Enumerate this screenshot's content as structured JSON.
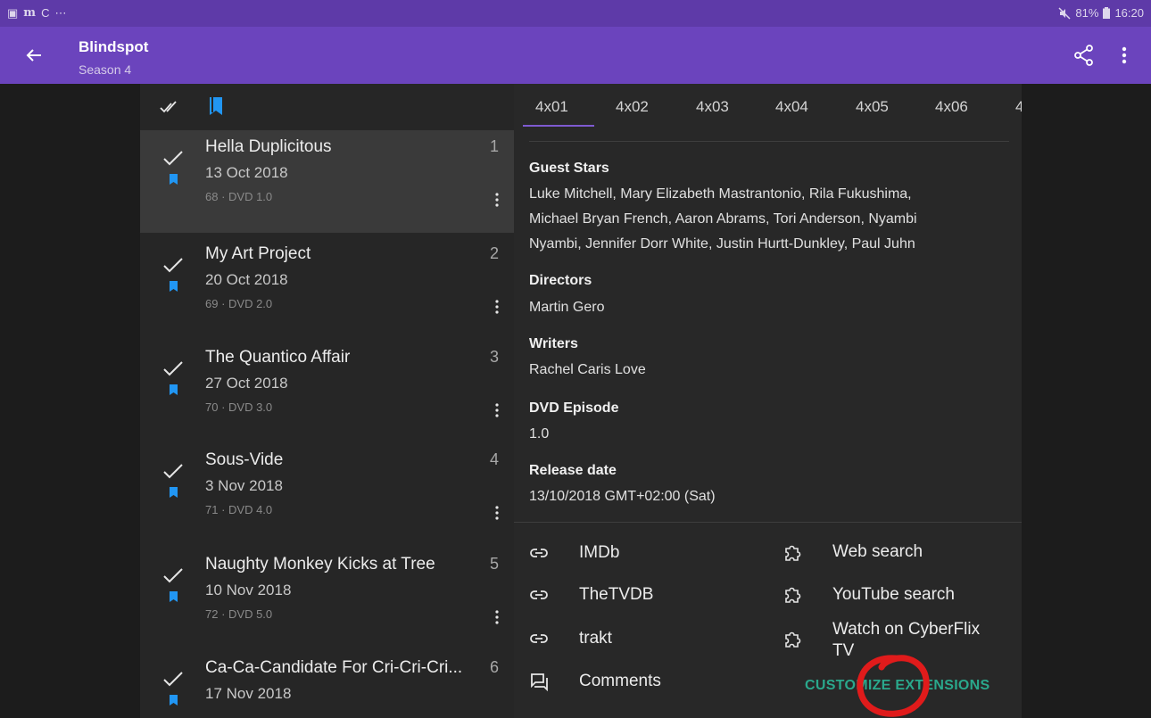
{
  "status_bar": {
    "left_icons": [
      "image-icon",
      "m-icon",
      "c-icon",
      "overflow-dots-icon"
    ],
    "left_glyphs": [
      "▣",
      "m",
      "C",
      "⋯"
    ],
    "battery": "81%",
    "time": "16:20"
  },
  "app_bar": {
    "title": "Blindspot",
    "subtitle": "Season 4"
  },
  "episodes": [
    {
      "title": "Hella Duplicitous",
      "number": "1",
      "date": "13 Oct 2018",
      "meta": "68 · DVD 1.0",
      "selected": true
    },
    {
      "title": "My Art Project",
      "number": "2",
      "date": "20 Oct 2018",
      "meta": "69 · DVD 2.0",
      "selected": false
    },
    {
      "title": "The Quantico Affair",
      "number": "3",
      "date": "27 Oct 2018",
      "meta": "70 · DVD 3.0",
      "selected": false
    },
    {
      "title": "Sous-Vide",
      "number": "4",
      "date": "3 Nov 2018",
      "meta": "71 · DVD 4.0",
      "selected": false
    },
    {
      "title": "Naughty Monkey Kicks at Tree",
      "number": "5",
      "date": "10 Nov 2018",
      "meta": "72 · DVD 5.0",
      "selected": false
    },
    {
      "title": "Ca-Ca-Candidate For Cri-Cri-Cri...",
      "number": "6",
      "date": "17 Nov 2018",
      "meta": "",
      "selected": false
    }
  ],
  "tabs": [
    "4x01",
    "4x02",
    "4x03",
    "4x04",
    "4x05",
    "4x06",
    "4"
  ],
  "details": {
    "guest_stars_label": "Guest Stars",
    "guest_stars_line1": "Luke Mitchell, Mary Elizabeth Mastrantonio, Rila Fukushima,",
    "guest_stars_line2": "Michael Bryan French, Aaron Abrams, Tori Anderson, Nyambi",
    "guest_stars_line3": "Nyambi, Jennifer Dorr White, Justin Hurtt-Dunkley, Paul Juhn",
    "directors_label": "Directors",
    "directors": "Martin Gero",
    "writers_label": "Writers",
    "writers": "Rachel Caris Love",
    "dvd_label": "DVD Episode",
    "dvd": "1.0",
    "release_label": "Release date",
    "release": "13/10/2018 GMT+02:00 (Sat)"
  },
  "links": {
    "imdb": "IMDb",
    "tvdb": "TheTVDB",
    "trakt": "trakt",
    "comments": "Comments",
    "web_search": "Web search",
    "youtube_search": "YouTube search",
    "cyberflix_line1": "Watch on CyberFlix",
    "cyberflix_line2": "TV",
    "customize": "CUSTOMIZE EXTENSIONS"
  },
  "colors": {
    "app_bar": "#6b44bd",
    "status_bar": "#5e3aa8",
    "accent_bookmark": "#2196f3",
    "accent_teal": "#2aa88c",
    "annotation": "#e01b1b"
  }
}
